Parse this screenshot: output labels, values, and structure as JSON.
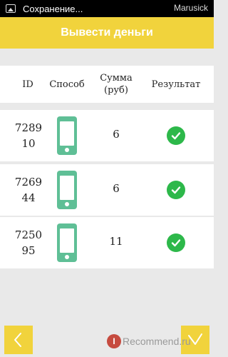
{
  "status_bar": {
    "text": "Сохранение...",
    "watermark": "Marusick"
  },
  "header": {
    "title": "Вывести деньги"
  },
  "table": {
    "columns": {
      "id": "ID",
      "method": "Способ",
      "sum_line1": "Сумма",
      "sum_line2": "(руб)",
      "result": "Результат"
    },
    "rows": [
      {
        "id_line1": "7289",
        "id_line2": "10",
        "method_icon": "phone-icon",
        "sum": "6",
        "result_icon": "check-circle-icon"
      },
      {
        "id_line1": "7269",
        "id_line2": "44",
        "method_icon": "phone-icon",
        "sum": "6",
        "result_icon": "check-circle-icon"
      },
      {
        "id_line1": "7250",
        "id_line2": "95",
        "method_icon": "phone-icon",
        "sum": "11",
        "result_icon": "check-circle-icon"
      }
    ]
  },
  "buttons": {
    "back_icon": "chevron-left-icon",
    "next_icon": "check-icon"
  },
  "watermark": {
    "badge": "I",
    "text": "Recommend.ru"
  },
  "colors": {
    "accent": "#f1d33c",
    "phone": "#5fbf96",
    "success": "#2db84a",
    "background": "#e9e9e9"
  }
}
